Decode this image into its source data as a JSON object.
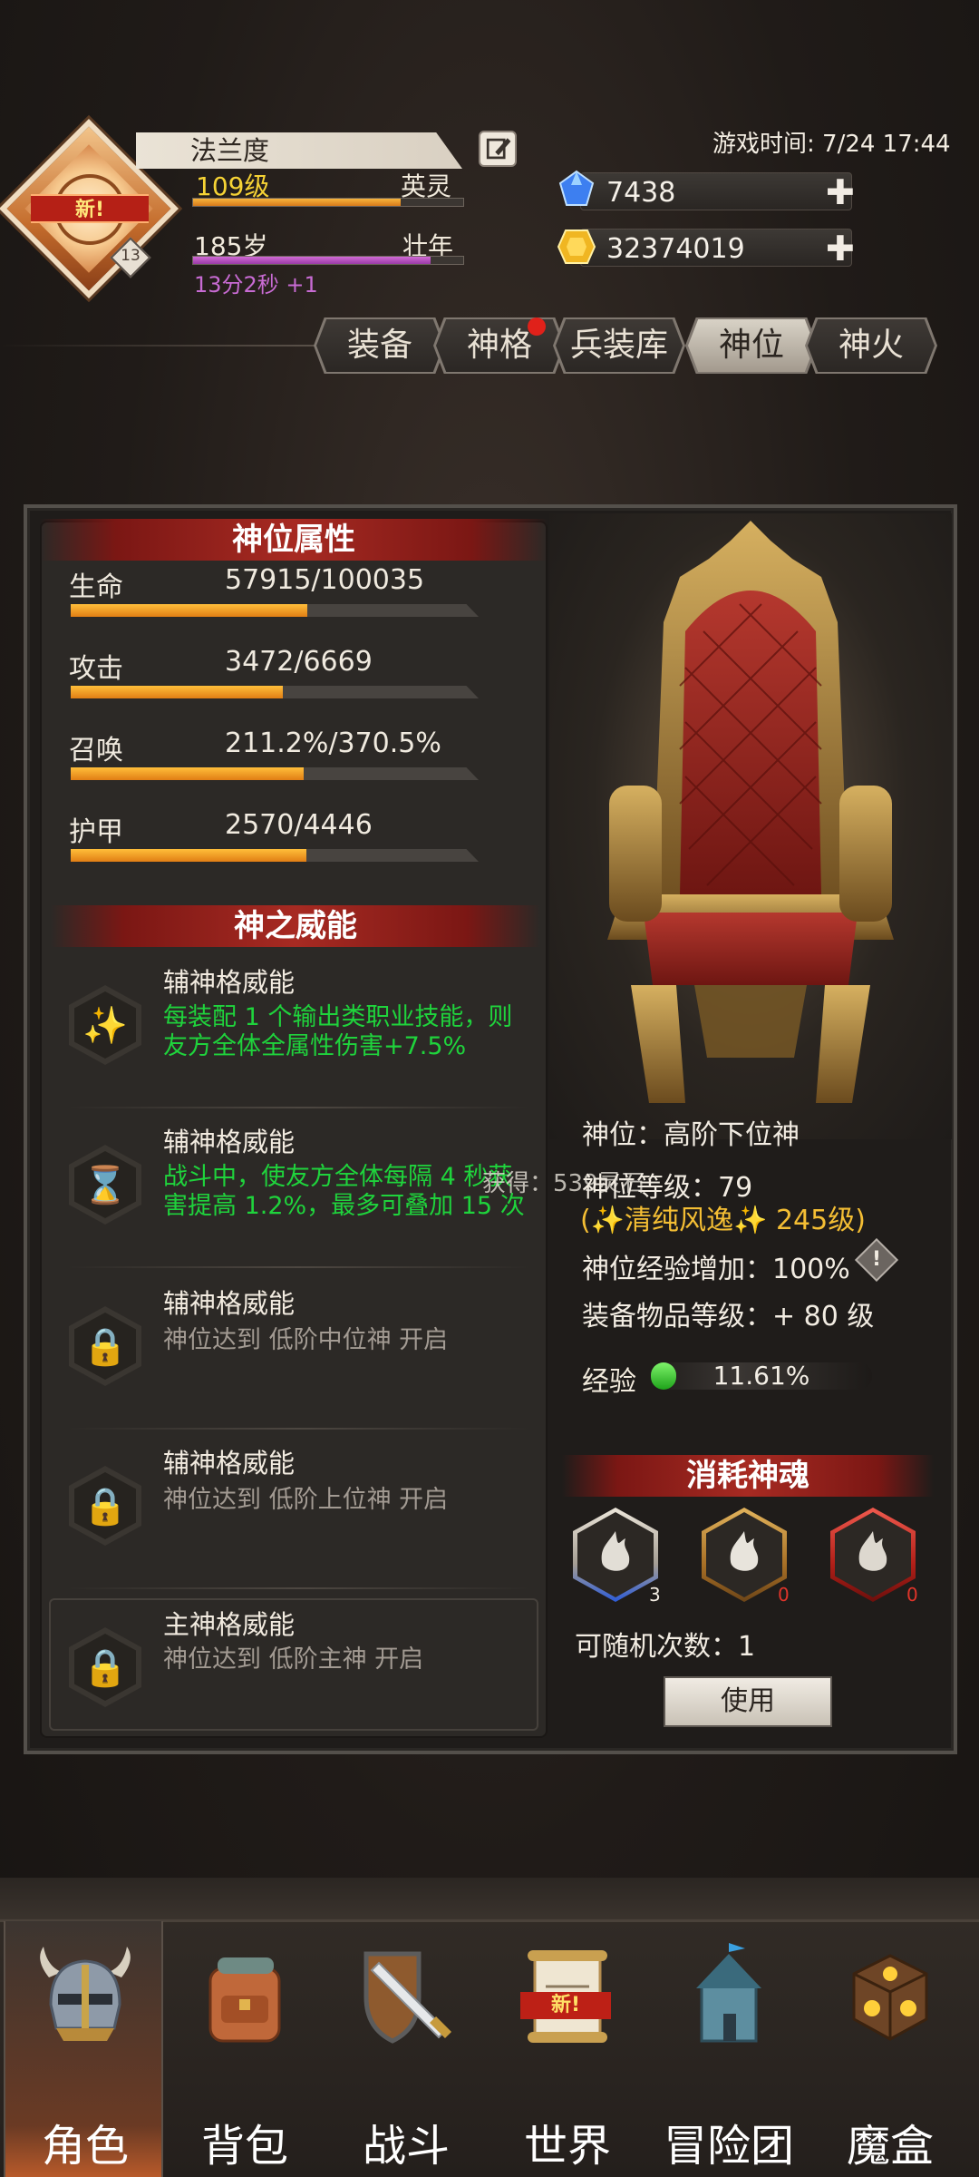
{
  "header": {
    "avatar_new": "新!",
    "avatar_level": "13",
    "name": "法兰度",
    "level": "109级",
    "rank_title": "英灵",
    "age": "185岁",
    "age_stage": "壮年",
    "age_timer": "13分2秒 +1",
    "game_time": "游戏时间: 7/24 17:44",
    "gems": "7438",
    "gold": "32374019",
    "plus": "✚"
  },
  "tabs": [
    "装备",
    "神格",
    "兵装库",
    "神位",
    "神火"
  ],
  "attr": {
    "title": "神位属性",
    "items": [
      {
        "name": "生命",
        "value": "57915/100035",
        "fraction": 0.579
      },
      {
        "name": "攻击",
        "value": "3472/6669",
        "fraction": 0.521
      },
      {
        "name": "召唤",
        "value": "211.2%/370.5%",
        "fraction": 0.57
      },
      {
        "name": "护甲",
        "value": "2570/4446",
        "fraction": 0.578
      }
    ]
  },
  "power": {
    "title": "神之威能",
    "skills": [
      {
        "title": "辅神格威能",
        "desc1": "每装配 1 个输出类职业技能，则",
        "desc2": "友方全体全属性伤害+7.5%"
      },
      {
        "title": "辅神格威能",
        "desc1": "战斗中，使友方全体每隔 4 秒获",
        "desc2": "害提高 1.2%，最多可叠加 15 次"
      },
      {
        "title": "辅神格威能",
        "desc1": "神位达到 低阶中位神 开启"
      },
      {
        "title": "辅神格威能",
        "desc1": "神位达到 低阶上位神 开启"
      },
      {
        "title": "主神格威能",
        "desc1": "神位达到 低阶主神 开启"
      }
    ]
  },
  "throne_info": {
    "rank": "神位：高阶下位神",
    "rank_level": "神位等级：79",
    "title_line": "(✨清纯风逸✨ 245级)",
    "exp_add": "神位经验增加：100%",
    "exp_add_icon": "!",
    "equip_level": "装备物品等级：+ 80 级",
    "exp_label": "经验",
    "exp_value": "11.61%",
    "exp_fraction": 0.1161
  },
  "soul": {
    "title": "消耗神魂",
    "counts": [
      "3",
      "0",
      "0"
    ],
    "reroll": "可随机次数：1",
    "use": "使用"
  },
  "toast": "获得：539灵石",
  "nav": [
    {
      "label": "角色",
      "icon": "helmet-icon"
    },
    {
      "label": "背包",
      "icon": "backpack-icon"
    },
    {
      "label": "战斗",
      "icon": "sword-shield-icon"
    },
    {
      "label": "世界",
      "icon": "scroll-map-icon",
      "badge": "新!"
    },
    {
      "label": "冒险团",
      "icon": "castle-icon"
    },
    {
      "label": "魔盒",
      "icon": "magic-box-icon"
    }
  ],
  "colors": {
    "accent_red": "#a72a22",
    "bar_orange": "#f0a030",
    "text_green": "#1fd33c",
    "text_gold": "#f4be34"
  }
}
